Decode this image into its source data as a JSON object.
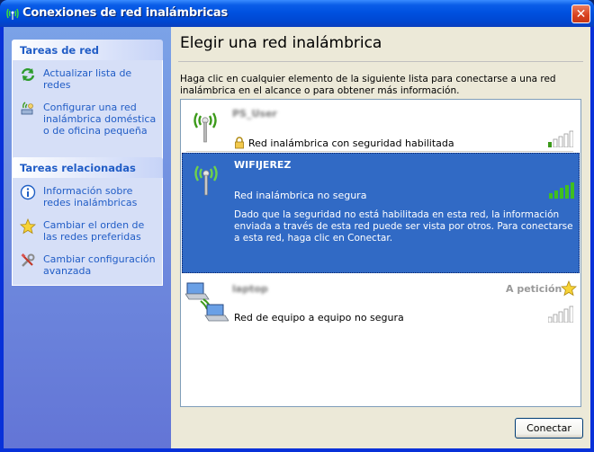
{
  "window": {
    "title": "Conexiones de red inalámbricas",
    "close_label": "✕"
  },
  "taskpane": {
    "groups": [
      {
        "header": "Tareas de red",
        "items": [
          {
            "label": "Actualizar lista de redes",
            "icon": "refresh-icon"
          },
          {
            "label": "Configurar una red inalámbrica doméstica o de oficina pequeña",
            "icon": "setup-wizard-icon"
          }
        ]
      },
      {
        "header": "Tareas relacionadas",
        "items": [
          {
            "label": "Información sobre redes inalámbricas",
            "icon": "info-icon"
          },
          {
            "label": "Cambiar el orden de las redes preferidas",
            "icon": "star-icon"
          },
          {
            "label": "Cambiar configuración avanzada",
            "icon": "tools-icon"
          }
        ]
      }
    ]
  },
  "main": {
    "title": "Elegir una red inalámbrica",
    "description": "Haga clic en cualquier elemento de la siguiente lista para conectarse a una red inalámbrica en el alcance o para obtener más información.",
    "networks": [
      {
        "name": "PS_User",
        "status": "Red inalámbrica con seguridad habilitada",
        "signal_bars": 1,
        "secured": true,
        "selected": false
      },
      {
        "name": "WIFIJEREZ",
        "status": "Red inalámbrica no segura",
        "detail": "Dado que la seguridad no está habilitada en esta red, la información enviada a través de esta red puede ser vista por otros. Para conectarse a esta red, haga clic en Conectar.",
        "signal_bars": 5,
        "secured": false,
        "selected": true
      },
      {
        "name": "laptop",
        "status": "Red de equipo a equipo no segura",
        "badge": "A petición",
        "signal_bars": 0,
        "adhoc": true,
        "selected": false
      }
    ],
    "connect_button": "Conectar"
  },
  "colors": {
    "title_blue": "#0054e3",
    "task_link": "#215dc6",
    "selection": "#316ac5",
    "signal_green": "#3c9a1a"
  }
}
